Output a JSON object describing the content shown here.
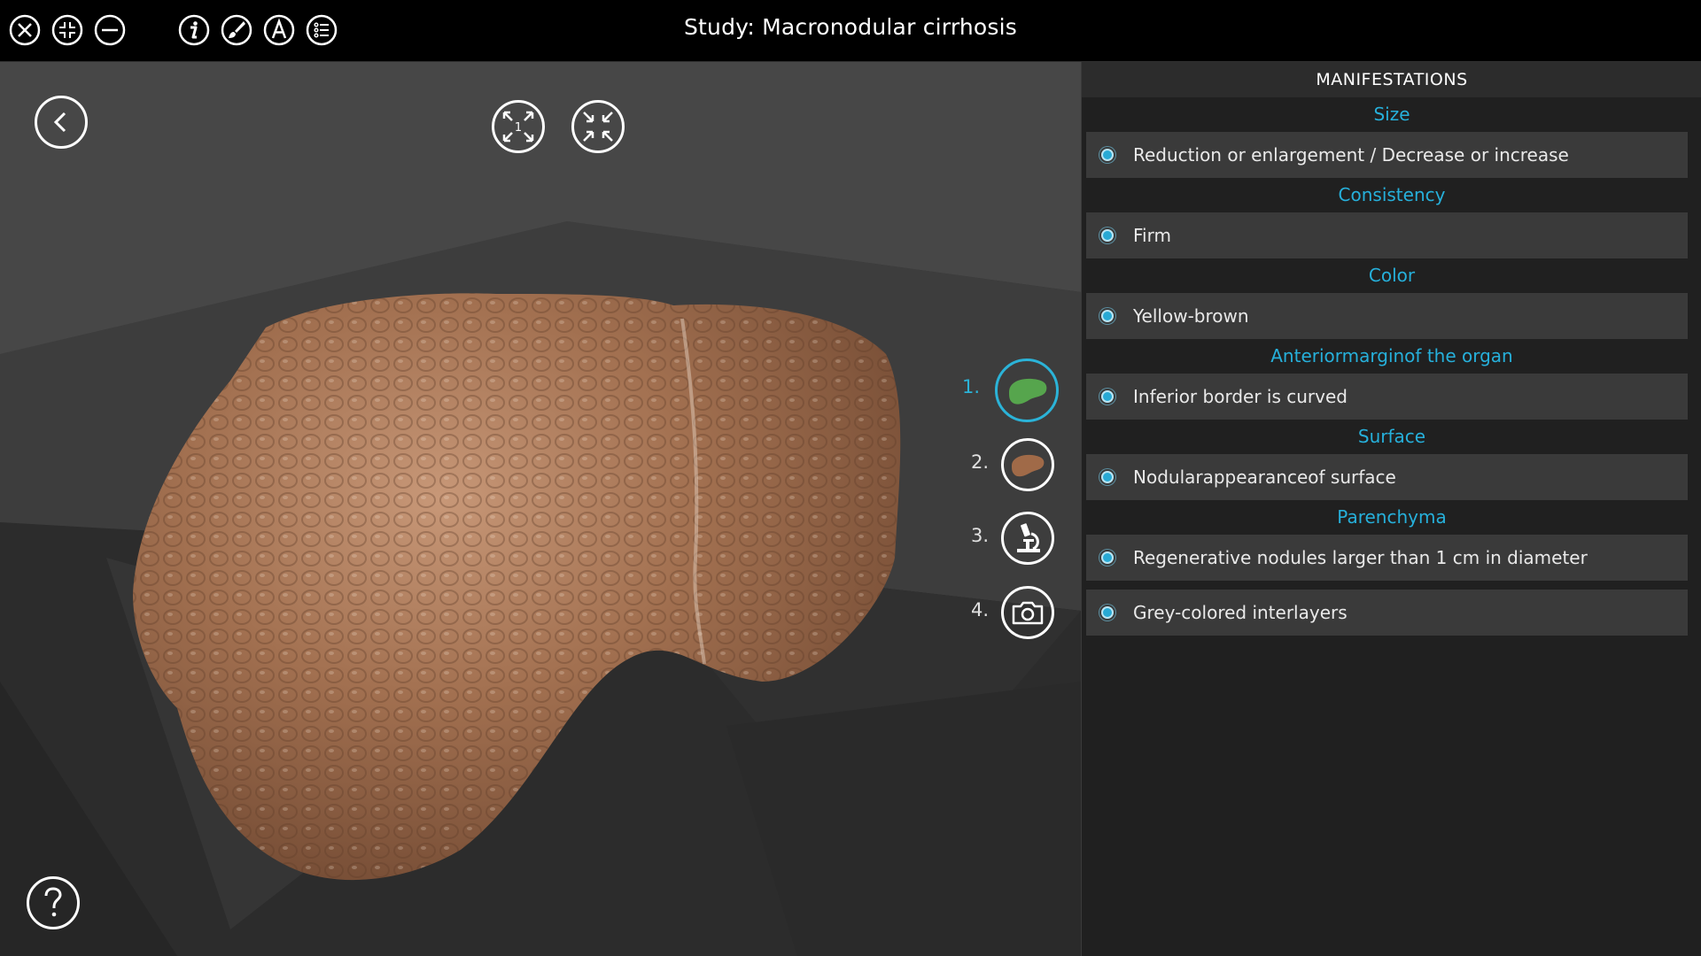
{
  "toolbar": {
    "buttons": [
      {
        "name": "close-button",
        "icon": "close-circle-icon"
      },
      {
        "name": "exit-fullscreen-button",
        "icon": "compress-icon"
      },
      {
        "name": "minimize-button",
        "icon": "minus-circle-icon"
      },
      {
        "name": "info-button",
        "icon": "info-icon"
      },
      {
        "name": "tools-button",
        "icon": "brush-icon"
      },
      {
        "name": "font-button",
        "icon": "letter-a-icon"
      },
      {
        "name": "list-button",
        "icon": "list-icon"
      }
    ]
  },
  "title": "Study: Macronodular cirrhosis",
  "viewport": {
    "back_icon": "chevron-left-icon",
    "view_buttons": [
      {
        "name": "expand-view-button",
        "icon": "expand-arrows-icon",
        "badge": "1"
      },
      {
        "name": "collapse-view-button",
        "icon": "collapse-arrows-icon"
      }
    ],
    "steps": [
      {
        "label": "1.",
        "icon": "liver-green-icon",
        "active": true
      },
      {
        "label": "2.",
        "icon": "liver-brown-icon",
        "active": false
      },
      {
        "label": "3.",
        "icon": "microscope-icon",
        "active": false
      },
      {
        "label": "4.",
        "icon": "camera-icon",
        "active": false
      }
    ],
    "help_icon": "question-mark-icon"
  },
  "panel": {
    "header": "MANIFESTATIONS",
    "sections": [
      {
        "title": "Size",
        "items": [
          "Reduction or enlargement / Decrease or increase"
        ]
      },
      {
        "title": "Consistency",
        "items": [
          "Firm"
        ]
      },
      {
        "title": "Color",
        "items": [
          "Yellow-brown"
        ]
      },
      {
        "title": "Anteriormarginof the organ",
        "items": [
          "Inferior border is curved"
        ]
      },
      {
        "title": "Surface",
        "items": [
          "Nodularappearanceof surface"
        ]
      },
      {
        "title": "Parenchyma",
        "items": [
          "Regenerative nodules larger than 1 cm in diameter",
          "Grey-colored interlayers"
        ]
      }
    ]
  },
  "colors": {
    "accent": "#26b0db",
    "topbar": "#000000",
    "panel_bg": "#202020",
    "item_bg": "#3a3a3a",
    "liver": "#9a6a4a"
  }
}
